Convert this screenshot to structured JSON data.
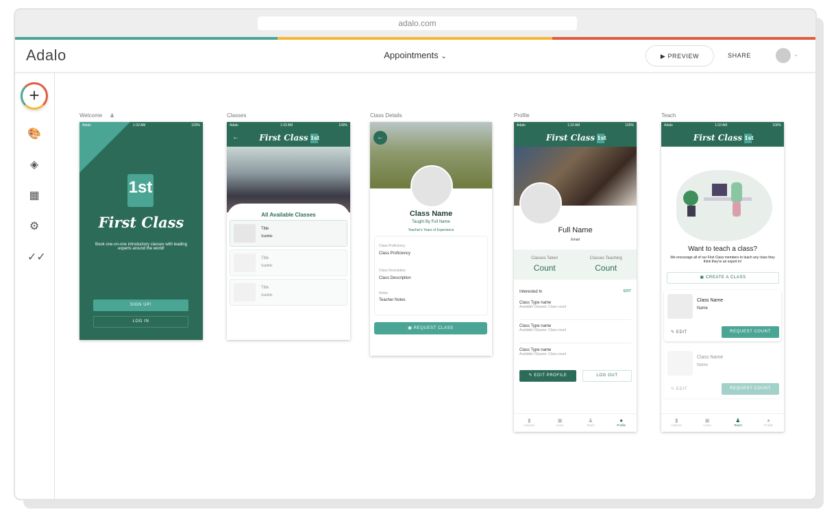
{
  "browser": {
    "url": "adalo.com"
  },
  "colors": {
    "teal": "#4aa595",
    "yellow": "#f5b935",
    "red": "#e05a3f",
    "dark_green": "#2b6b58"
  },
  "header": {
    "logo": "Adalo",
    "app_name": "Appointments",
    "preview": "PREVIEW",
    "share": "SHARE"
  },
  "sidebar": {
    "icons": [
      "add-icon",
      "palette-icon",
      "layers-icon",
      "database-icon",
      "gear-icon",
      "check-all-icon"
    ]
  },
  "status": {
    "carrier": "Adalo",
    "time": "1:33 AM",
    "battery": "100%"
  },
  "brand": {
    "title": "First Class",
    "badge": "1st"
  },
  "screens": {
    "welcome": {
      "label": "Welcome",
      "tagline": "Book one-on-one introductory classes with leading experts around the world!",
      "signup": "SIGN UP!",
      "login": "LOG IN"
    },
    "classes": {
      "label": "Classes",
      "heading": "All Available Classes",
      "items": [
        {
          "title": "Title",
          "subtitle": "Subtitle"
        },
        {
          "title": "Title",
          "subtitle": "Subtitle"
        },
        {
          "title": "Title",
          "subtitle": "Subtitle"
        }
      ]
    },
    "details": {
      "label": "Class Details",
      "name": "Class Name",
      "taught": "Taught By Full Name",
      "experience": "Teacher's Years of Experience",
      "fields": [
        {
          "label": "Class Proficiency",
          "value": "Class Proficiency"
        },
        {
          "label": "Class Description",
          "value": "Class Description"
        },
        {
          "label": "Notes",
          "value": "Teacher Notes"
        }
      ],
      "button": "REQUEST CLASS"
    },
    "profile": {
      "label": "Profile",
      "name": "Full Name",
      "email": "Email",
      "stats": [
        {
          "label": "Classes Taken",
          "value": "Count"
        },
        {
          "label": "Classes Teaching",
          "value": "Count"
        }
      ],
      "interested": "Interested In",
      "edit": "EDIT",
      "items": [
        {
          "name": "Class Type name",
          "sub": "Available Classes: Class count"
        },
        {
          "name": "Class Type name",
          "sub": "Available Classes: Class count"
        },
        {
          "name": "Class Type name",
          "sub": "Available Classes: Class count"
        }
      ],
      "edit_profile": "EDIT PROFILE",
      "logout": "LOG OUT"
    },
    "teach": {
      "label": "Teach",
      "title": "Want to teach a class?",
      "text": "We encourage all of our First Class members to teach any class they think they're an expert in!",
      "create": "CREATE A CLASS",
      "cards": [
        {
          "name": "Class Name",
          "sub": "Name",
          "edit": "EDIT",
          "request": "REQUEST COUNT"
        },
        {
          "name": "Class Name",
          "sub": "Name",
          "edit": "EDIT",
          "request": "REQUEST COUNT"
        }
      ]
    }
  },
  "tabs": [
    "Classes",
    "Learn",
    "Teach",
    "Profile"
  ]
}
